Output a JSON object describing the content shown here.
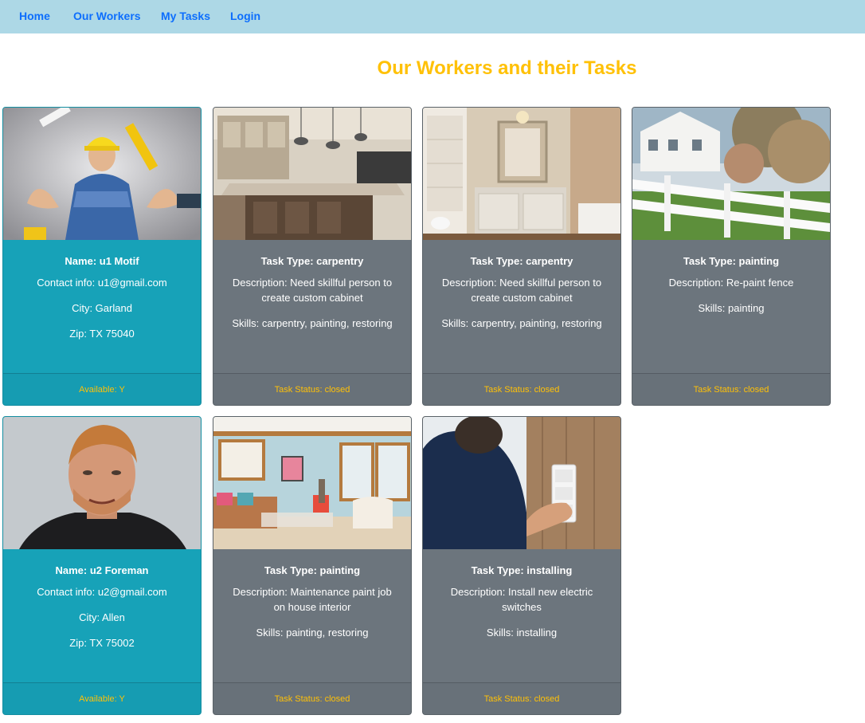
{
  "nav": {
    "items": [
      {
        "label": "Home"
      },
      {
        "label": "Our Workers"
      },
      {
        "label": "My Tasks"
      },
      {
        "label": "Login"
      }
    ]
  },
  "page": {
    "title": "Our Workers and their Tasks"
  },
  "colors": {
    "navbar": "#add8e6",
    "link": "#0d6efd",
    "title": "#ffc107",
    "worker_card": "#17a2b8",
    "task_card": "#6c757d",
    "footer_text": "#ffc107"
  },
  "rows": [
    {
      "worker": {
        "image": "handyman-with-tools-photo",
        "name": "Name: u1 Motif",
        "contact": "Contact info: u1@gmail.com",
        "city": "City: Garland",
        "zip": "Zip: TX 75040",
        "footer": "Available: Y"
      },
      "tasks": [
        {
          "image": "kitchen-cabinets-photo",
          "type": "Task Type: carpentry",
          "description": "Description: Need skillful person to create custom cabinet",
          "skills": "Skills: carpentry, painting, restoring",
          "status": "Task Status: closed"
        },
        {
          "image": "bathroom-cabinet-photo",
          "type": "Task Type: carpentry",
          "description": "Description: Need skillful person to create custom cabinet",
          "skills": "Skills: carpentry, painting, restoring",
          "status": "Task Status: closed"
        },
        {
          "image": "white-fence-photo",
          "type": "Task Type: painting",
          "description": "Description: Re-paint fence",
          "skills": "Skills: painting",
          "status": "Task Status: closed"
        }
      ]
    },
    {
      "worker": {
        "image": "man-portrait-photo",
        "name": "Name: u2 Foreman",
        "contact": "Contact info: u2@gmail.com",
        "city": "City: Allen",
        "zip": "Zip: TX 75002",
        "footer": "Available: Y"
      },
      "tasks": [
        {
          "image": "living-room-photo",
          "type": "Task Type: painting",
          "description": "Description: Maintenance paint job on house interior",
          "skills": "Skills: painting, restoring",
          "status": "Task Status: closed"
        },
        {
          "image": "light-switch-photo",
          "type": "Task Type: installing",
          "description": "Description: Install new electric switches",
          "skills": "Skills: installing",
          "status": "Task Status: closed"
        }
      ]
    }
  ]
}
